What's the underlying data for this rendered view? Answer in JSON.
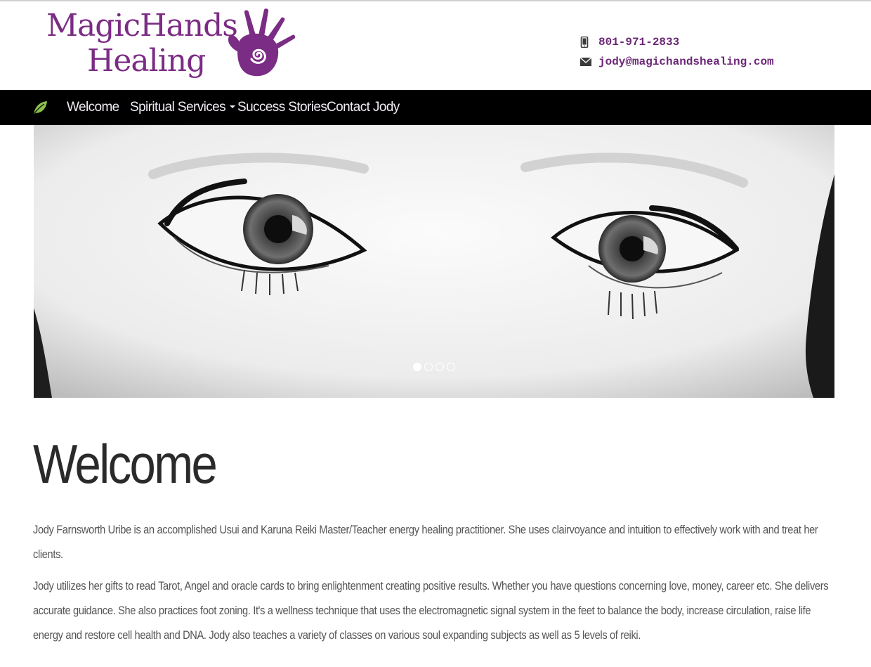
{
  "header": {
    "logo": {
      "line1": "MagicHands",
      "line2": "Healing",
      "icon": "spiral-hand-logo"
    },
    "contact": {
      "phone": {
        "icon": "mobile-phone-icon",
        "text": "801-971-2833"
      },
      "email": {
        "icon": "envelope-icon",
        "text": "jody@magichandshealing.com"
      }
    }
  },
  "nav": {
    "home_icon": "leaf-icon",
    "items": [
      {
        "label": "Welcome"
      },
      {
        "label": "Spiritual Services",
        "dropdown": true
      },
      {
        "label": "Success Stories"
      },
      {
        "label": "Contact Jody"
      }
    ]
  },
  "carousel": {
    "slide_count": 4,
    "active_slide": 1
  },
  "main": {
    "title": "Welcome",
    "paragraphs": [
      "Jody Farnsworth Uribe is an accomplished Usui and Karuna Reiki Master/Teacher energy healing practitioner. She uses clairvoyance and intuition to effectively work with and treat her clients.",
      "Jody utilizes her gifts to read Tarot, Angel and oracle cards to bring enlightenment creating positive results. Whether you have questions concerning love, money, career etc. She delivers accurate guidance. She also practices foot zoning. It's a wellness technique that uses the electromagnetic signal system in the feet to balance the body, increase circulation, raise life energy and restore cell health and DNA. Jody also teaches a variety of classes on various soul expanding subjects as well as 5 levels of reiki."
    ]
  },
  "colors": {
    "brand_purple": "#7b2c84",
    "nav_background": "#000000",
    "leaf_green": "#8cc04b"
  }
}
